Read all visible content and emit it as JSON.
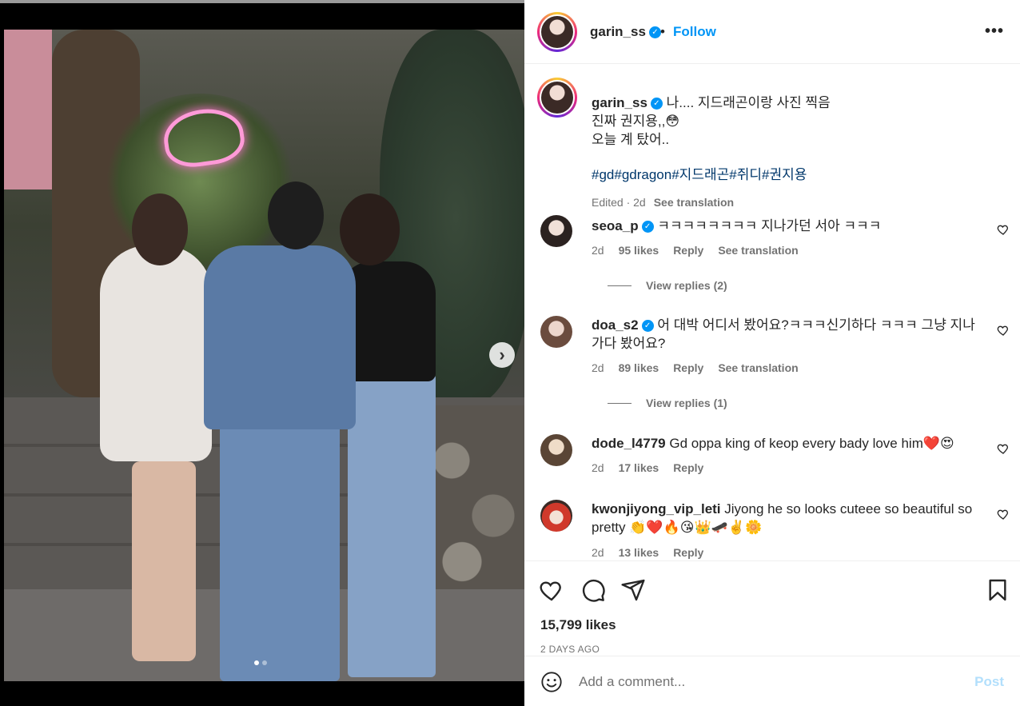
{
  "post": {
    "username": "garin_ss",
    "follow_label": "Follow",
    "separator": "•",
    "more_label": "•••"
  },
  "caption": {
    "username": "garin_ss",
    "lines": [
      "나.... 지드래곤이랑 사진 찍음",
      "진짜 권지용,,😳",
      "오늘 계 탔어.."
    ],
    "hashtags": [
      "#gd",
      "#gdragon",
      "#지드래곤",
      "#쥐디",
      "#권지용"
    ],
    "edited": "Edited · 2d",
    "see_translation": "See translation"
  },
  "comments": [
    {
      "username": "seoa_p",
      "verified": true,
      "text": "ㅋㅋㅋㅋㅋㅋㅋㅋ 지나가던 서아 ㅋㅋㅋ",
      "age": "2d",
      "likes": "95 likes",
      "reply": "Reply",
      "translate": "See translation",
      "view_replies": "View replies (2)",
      "avatar_color": "#d9c2b5"
    },
    {
      "username": "doa_s2",
      "verified": true,
      "text": "어 대박 어디서 봤어요?ㅋㅋㅋ신기하다 ㅋㅋㅋ 그냥 지나가다 봤어요?",
      "age": "2d",
      "likes": "89 likes",
      "reply": "Reply",
      "translate": "See translation",
      "view_replies": "View replies (1)",
      "avatar_color": "#c4a99c"
    },
    {
      "username": "dode_l4779",
      "verified": false,
      "text": "Gd oppa king of keop every bady love him❤️😍",
      "age": "2d",
      "likes": "17 likes",
      "reply": "Reply",
      "avatar_color": "#a89070"
    },
    {
      "username": "kwonjiyong_vip_leti",
      "verified": false,
      "text": "Jiyong he so looks cuteee so beautiful so pretty 👏❤️🔥😘👑🛹✌️🌼",
      "age": "2d",
      "likes": "13 likes",
      "reply": "Reply",
      "avatar_color": "#d0392b"
    }
  ],
  "stats": {
    "likes": "15,799 likes",
    "date": "2 DAYS AGO"
  },
  "compose": {
    "placeholder": "Add a comment...",
    "post_label": "Post"
  },
  "icons": {
    "like": "heart-icon",
    "comment": "comment-icon",
    "share": "share-icon",
    "save": "bookmark-icon",
    "emoji": "emoji-icon",
    "next": "chevron-right-icon",
    "verified": "verified-badge-icon"
  },
  "colors": {
    "accent": "#0095f6",
    "hashtag": "#00376b",
    "muted": "#737373",
    "post_disabled": "#b2dffc"
  },
  "carousel": {
    "slide_count": 2,
    "active_index": 0
  }
}
